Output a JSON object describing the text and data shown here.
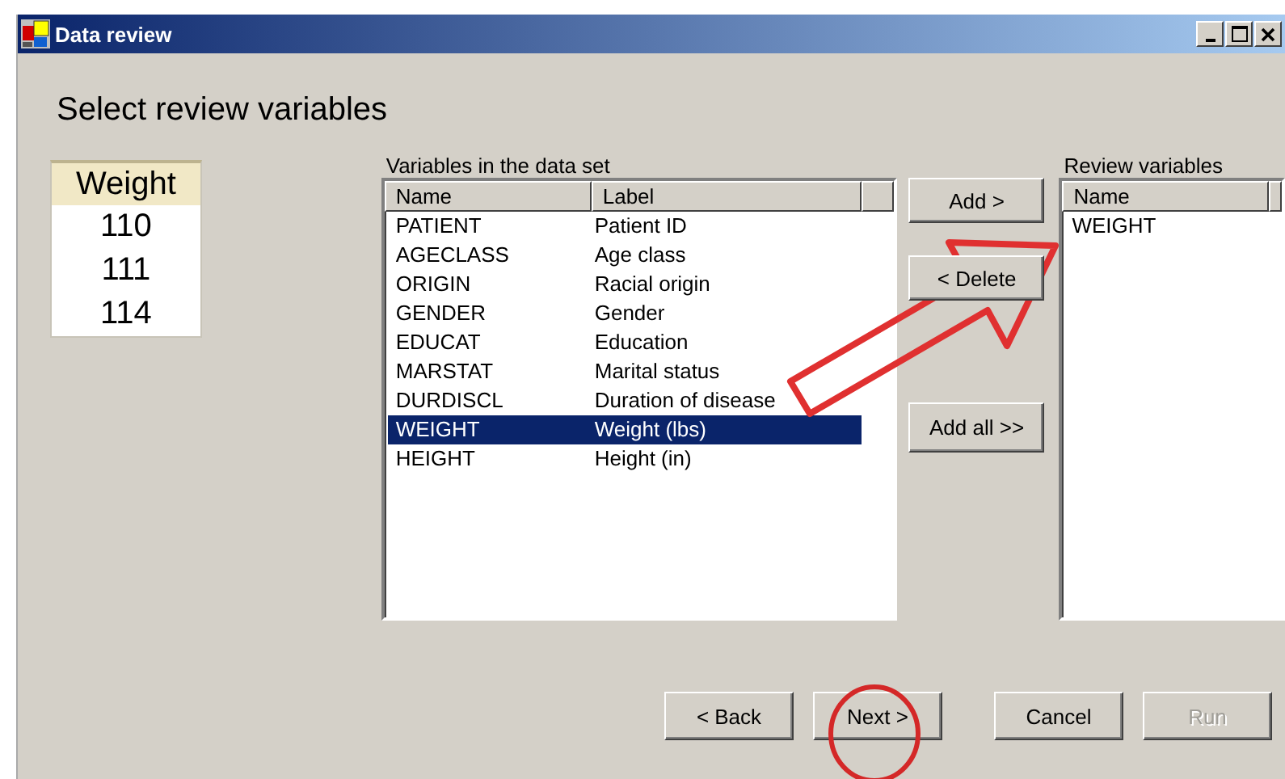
{
  "window": {
    "title": "Data review"
  },
  "heading": "Select review variables",
  "preview": {
    "header": "Weight",
    "values": [
      "110",
      "111",
      "114"
    ]
  },
  "dataset": {
    "label": "Variables in the data set",
    "columns": [
      "Name",
      "Label"
    ],
    "rows": [
      {
        "name": "PATIENT",
        "label": "Patient ID",
        "selected": false
      },
      {
        "name": "AGECLASS",
        "label": "Age class",
        "selected": false
      },
      {
        "name": "ORIGIN",
        "label": "Racial origin",
        "selected": false
      },
      {
        "name": "GENDER",
        "label": "Gender",
        "selected": false
      },
      {
        "name": "EDUCAT",
        "label": "Education",
        "selected": false
      },
      {
        "name": "MARSTAT",
        "label": "Marital status",
        "selected": false
      },
      {
        "name": "DURDISCL",
        "label": "Duration of disease",
        "selected": false
      },
      {
        "name": "WEIGHT",
        "label": "Weight (lbs)",
        "selected": true
      },
      {
        "name": "HEIGHT",
        "label": "Height (in)",
        "selected": false
      }
    ]
  },
  "move_buttons": [
    "Add >",
    "< Delete",
    "Add all >>"
  ],
  "review": {
    "label": "Review variables",
    "columns": [
      "Name"
    ],
    "rows": [
      "WEIGHT"
    ]
  },
  "footer_buttons": [
    {
      "label": "< Back",
      "disabled": false
    },
    {
      "label": "Next >",
      "disabled": false
    },
    {
      "label": "Cancel",
      "disabled": false
    },
    {
      "label": "Run",
      "disabled": true
    }
  ]
}
